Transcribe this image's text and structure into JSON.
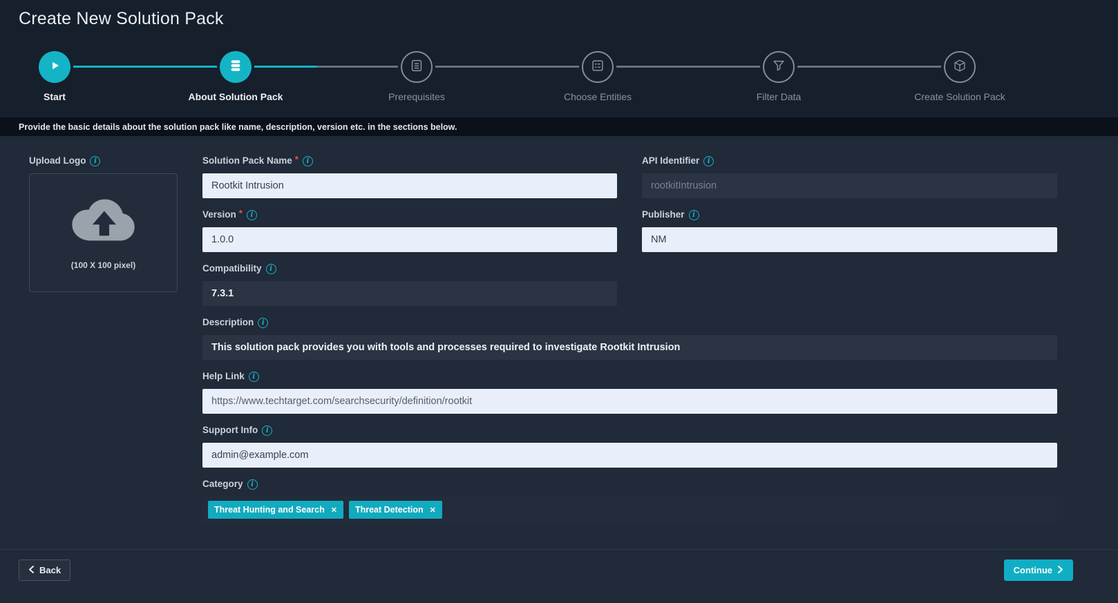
{
  "header": {
    "title": "Create New Solution Pack"
  },
  "stepper": {
    "steps": [
      {
        "label": "Start",
        "state": "complete",
        "icon": "play-icon"
      },
      {
        "label": "About Solution Pack",
        "state": "active",
        "icon": "database-icon"
      },
      {
        "label": "Prerequisites",
        "state": "pending",
        "icon": "checklist-icon"
      },
      {
        "label": "Choose Entities",
        "state": "pending",
        "icon": "entities-icon"
      },
      {
        "label": "Filter Data",
        "state": "pending",
        "icon": "funnel-icon"
      },
      {
        "label": "Create Solution Pack",
        "state": "pending",
        "icon": "package-icon"
      }
    ]
  },
  "info_bar": {
    "text": "Provide the basic details about the solution pack like name, description, version etc. in the sections below."
  },
  "form": {
    "required_mark": "*",
    "upload_logo": {
      "label": "Upload Logo",
      "hint": "(100 X 100 pixel)"
    },
    "fields": {
      "solution_pack_name": {
        "label": "Solution Pack Name",
        "required": true,
        "value": "Rootkit Intrusion"
      },
      "api_identifier": {
        "label": "API Identifier",
        "required": false,
        "value": "rootkitIntrusion",
        "disabled": true
      },
      "version": {
        "label": "Version",
        "required": true,
        "value": "1.0.0"
      },
      "publisher": {
        "label": "Publisher",
        "required": false,
        "value": "NM"
      },
      "compatibility": {
        "label": "Compatibility",
        "required": false,
        "value": "7.3.1"
      },
      "description": {
        "label": "Description",
        "required": false,
        "value": "This solution pack provides you with tools and processes required to investigate Rootkit Intrusion"
      },
      "help_link": {
        "label": "Help Link",
        "required": false,
        "value": "https://www.techtarget.com/searchsecurity/definition/rootkit"
      },
      "support_info": {
        "label": "Support Info",
        "required": false,
        "value": "admin@example.com"
      },
      "category": {
        "label": "Category",
        "required": false,
        "tags": [
          "Threat Hunting and Search",
          "Threat Detection"
        ]
      }
    }
  },
  "footer": {
    "back_label": "Back",
    "continue_label": "Continue"
  },
  "colors": {
    "accent": "#14b4c6",
    "required": "#ef5350",
    "tag": "#12aabf",
    "input_light": "#e9effa",
    "input_dark": "#2a3443"
  }
}
